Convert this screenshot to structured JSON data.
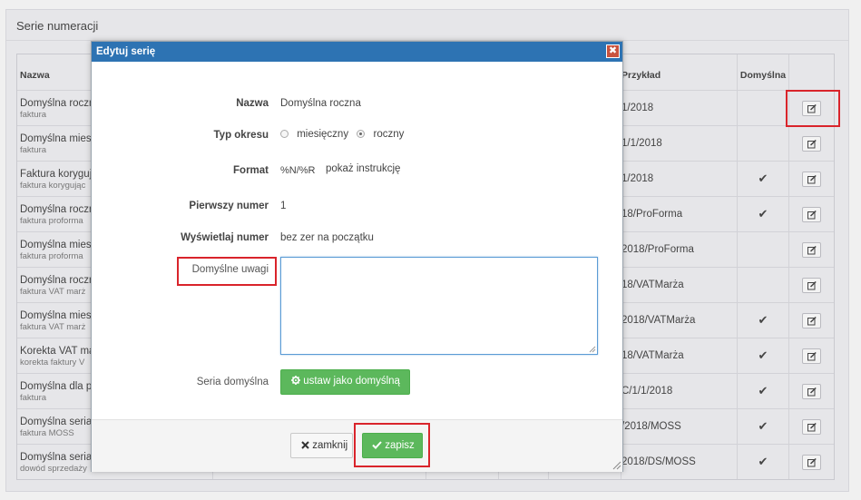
{
  "panel": {
    "title": "Serie numeracji"
  },
  "table": {
    "headers": {
      "name": "Nazwa",
      "example": "Przykład",
      "default": "Domyślna"
    },
    "rows": [
      {
        "name": "Domyślna roczn",
        "type": "faktura",
        "example": "1/2018",
        "default": ""
      },
      {
        "name": "Domyślna miesi",
        "type": "faktura",
        "example": "1/1/2018",
        "default": ""
      },
      {
        "name": "Faktura koryguj",
        "type": "faktura korygując",
        "example": "1/2018",
        "default": "✔"
      },
      {
        "name": "Domyślna roczn",
        "type": "faktura proforma",
        "example": "18/ProForma",
        "default": "✔"
      },
      {
        "name": "Domyślna miesi",
        "type": "faktura proforma",
        "example": "2018/ProForma",
        "default": ""
      },
      {
        "name": "Domyślna roczn",
        "type": "faktura VAT marż",
        "example": "18/VATMarża",
        "default": ""
      },
      {
        "name": "Domyślna miesi",
        "type": "faktura VAT marż",
        "example": "2018/VATMarża",
        "default": "✔"
      },
      {
        "name": "Korekta VAT ma",
        "type": "korekta faktury V",
        "example": "18/VATMarża",
        "default": "✔"
      },
      {
        "name": "Domyślna dla p",
        "type": "faktura",
        "example": "C/1/1/2018",
        "default": "✔"
      },
      {
        "name": "Domyślna seria",
        "type": "faktura MOSS",
        "example": "/2018/MOSS",
        "default": "✔"
      },
      {
        "name": "Domyślna seria",
        "type": "dowód sprzedaży",
        "example": "2018/DS/MOSS",
        "default": "✔"
      }
    ]
  },
  "modal": {
    "title": "Edytuj serię",
    "close_glyph": "✖",
    "fields": {
      "name_label": "Nazwa",
      "name_value": "Domyślna roczna",
      "period_label": "Typ okresu",
      "period_monthly": "miesięczny",
      "period_yearly": "roczny",
      "period_selected": "roczny",
      "format_label": "Format",
      "format_value": "%N/%R",
      "format_help": "pokaż instrukcję",
      "first_label": "Pierwszy numer",
      "first_value": "1",
      "display_label": "Wyświetlaj numer",
      "display_value": "bez zer na początku",
      "notes_label": "Domyślne uwagi",
      "notes_value": "",
      "default_label": "Seria domyślna",
      "set_default_button": "ustaw jako domyślną"
    },
    "footer": {
      "close_button": "zamknij",
      "save_button": "zapisz"
    }
  },
  "icons": {
    "edit": "edit-icon",
    "check": "check-icon",
    "gear": "gear-icon",
    "close": "close-icon"
  },
  "colors": {
    "title_bar": "#2d73b3",
    "green": "#5cb85c",
    "highlight": "#d9242b"
  }
}
